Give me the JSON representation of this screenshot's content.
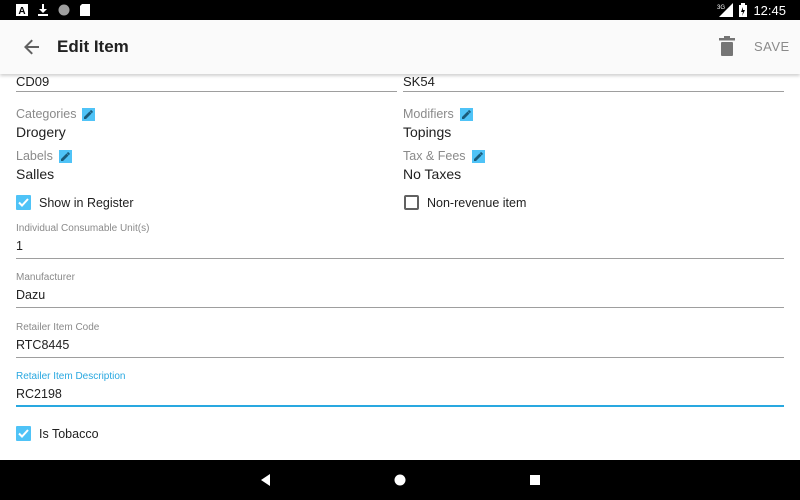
{
  "status_bar": {
    "left_icons": [
      "app-icon",
      "download-icon",
      "sync-icon",
      "sd-card-icon"
    ],
    "network": "3G",
    "time": "12:45"
  },
  "app_bar": {
    "title": "Edit Item",
    "save_label": "SAVE"
  },
  "codes": {
    "left_value": "CD09",
    "right_value": "SK54"
  },
  "categories": {
    "label": "Categories",
    "value": "Drogery"
  },
  "modifiers": {
    "label": "Modifiers",
    "value": "Topings"
  },
  "labels": {
    "label": "Labels",
    "value": "Salles"
  },
  "tax_fees": {
    "label": "Tax & Fees",
    "value": "No Taxes"
  },
  "show_in_register": {
    "label": "Show in Register",
    "checked": true
  },
  "non_revenue": {
    "label": "Non-revenue item",
    "checked": false
  },
  "fields": {
    "consumable_units": {
      "label": "Individual Consumable Unit(s)",
      "value": "1"
    },
    "manufacturer": {
      "label": "Manufacturer",
      "value": "Dazu"
    },
    "retailer_code": {
      "label": "Retailer Item Code",
      "value": "RTC8445"
    },
    "retailer_description": {
      "label": "Retailer Item Description",
      "value": "RC2198"
    }
  },
  "is_tobacco": {
    "label": "Is Tobacco",
    "checked": true
  },
  "colors": {
    "accent": "#29a8e0",
    "checkbox": "#4fc3f7",
    "appbar_bg": "#fafafa"
  }
}
